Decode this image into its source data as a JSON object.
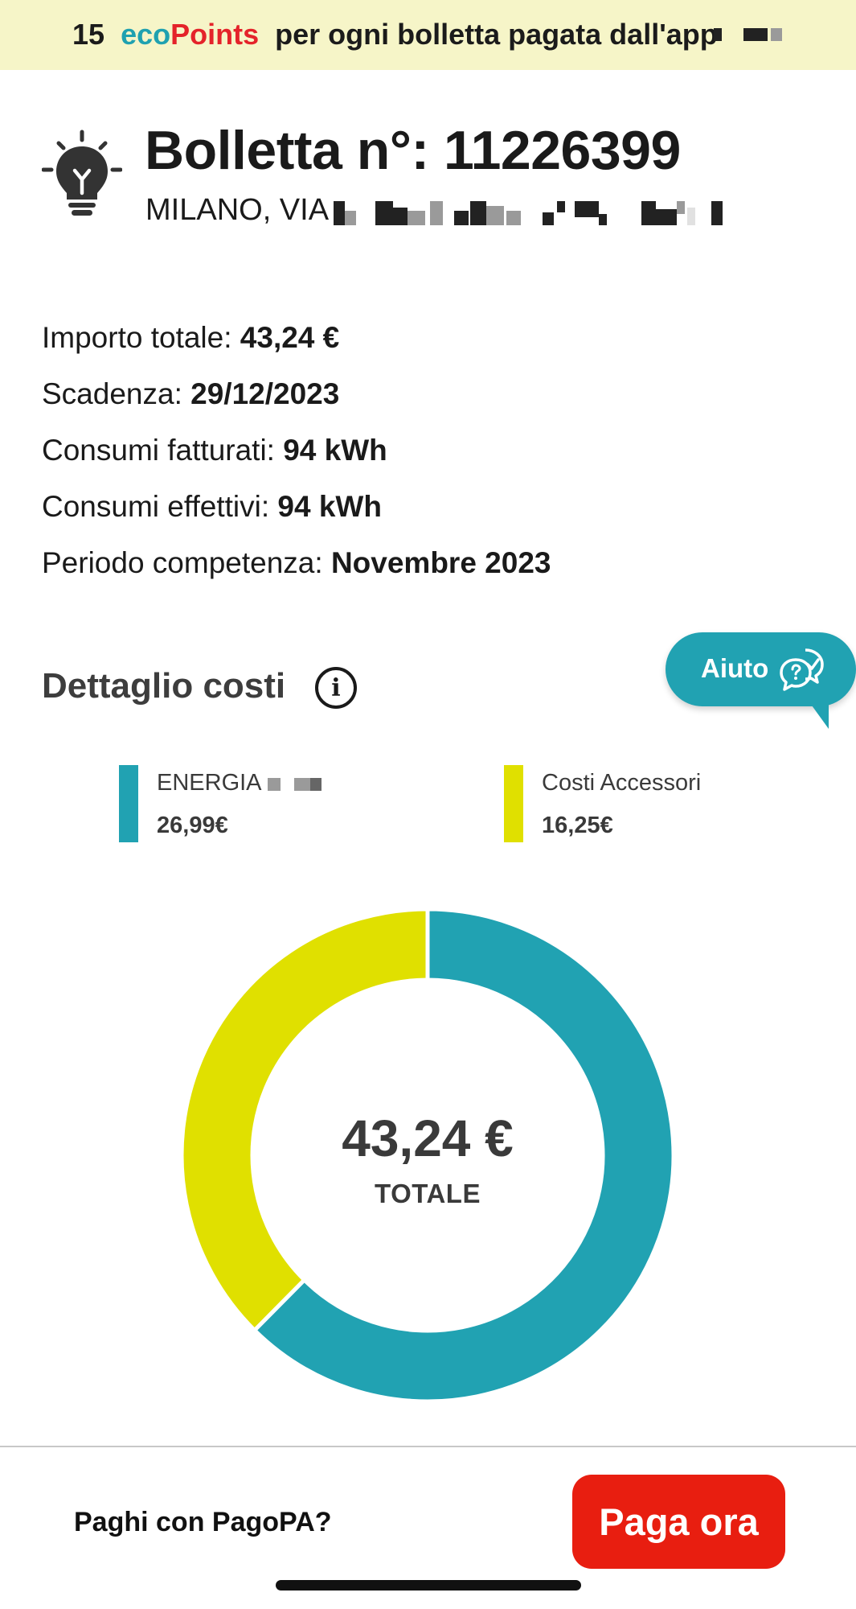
{
  "banner": {
    "points": "15",
    "eco": "eco",
    "points_word": "Points",
    "text": "per ogni bolletta pagata dall'app"
  },
  "bill": {
    "title": "Bolletta n°: 11226399",
    "address": "MILANO, VIA"
  },
  "details": [
    {
      "label": "Importo totale: ",
      "value": "43,24 €"
    },
    {
      "label": "Scadenza: ",
      "value": "29/12/2023"
    },
    {
      "label": "Consumi fatturati: ",
      "value": "94 kWh"
    },
    {
      "label": "Consumi effettivi: ",
      "value": "94 kWh"
    },
    {
      "label": "Periodo competenza: ",
      "value": "Novembre 2023"
    }
  ],
  "section": {
    "title": "Dettaglio costi",
    "info_icon": "info-circle-icon"
  },
  "help": {
    "label": "Aiuto",
    "icon": "chat-bubbles-icon"
  },
  "chart_data": {
    "type": "pie",
    "title": "",
    "center_value": "43,24 €",
    "center_label": "TOTALE",
    "categories": [
      "ENERGIA",
      "Costi Accessori"
    ],
    "value_labels": [
      "26,99€",
      "16,25€"
    ],
    "values": [
      26.99,
      16.25
    ],
    "colors": [
      "#21a2b2",
      "#e0e000"
    ]
  },
  "footer": {
    "question": "Paghi con PagoPA?",
    "pay_button": "Paga ora"
  }
}
